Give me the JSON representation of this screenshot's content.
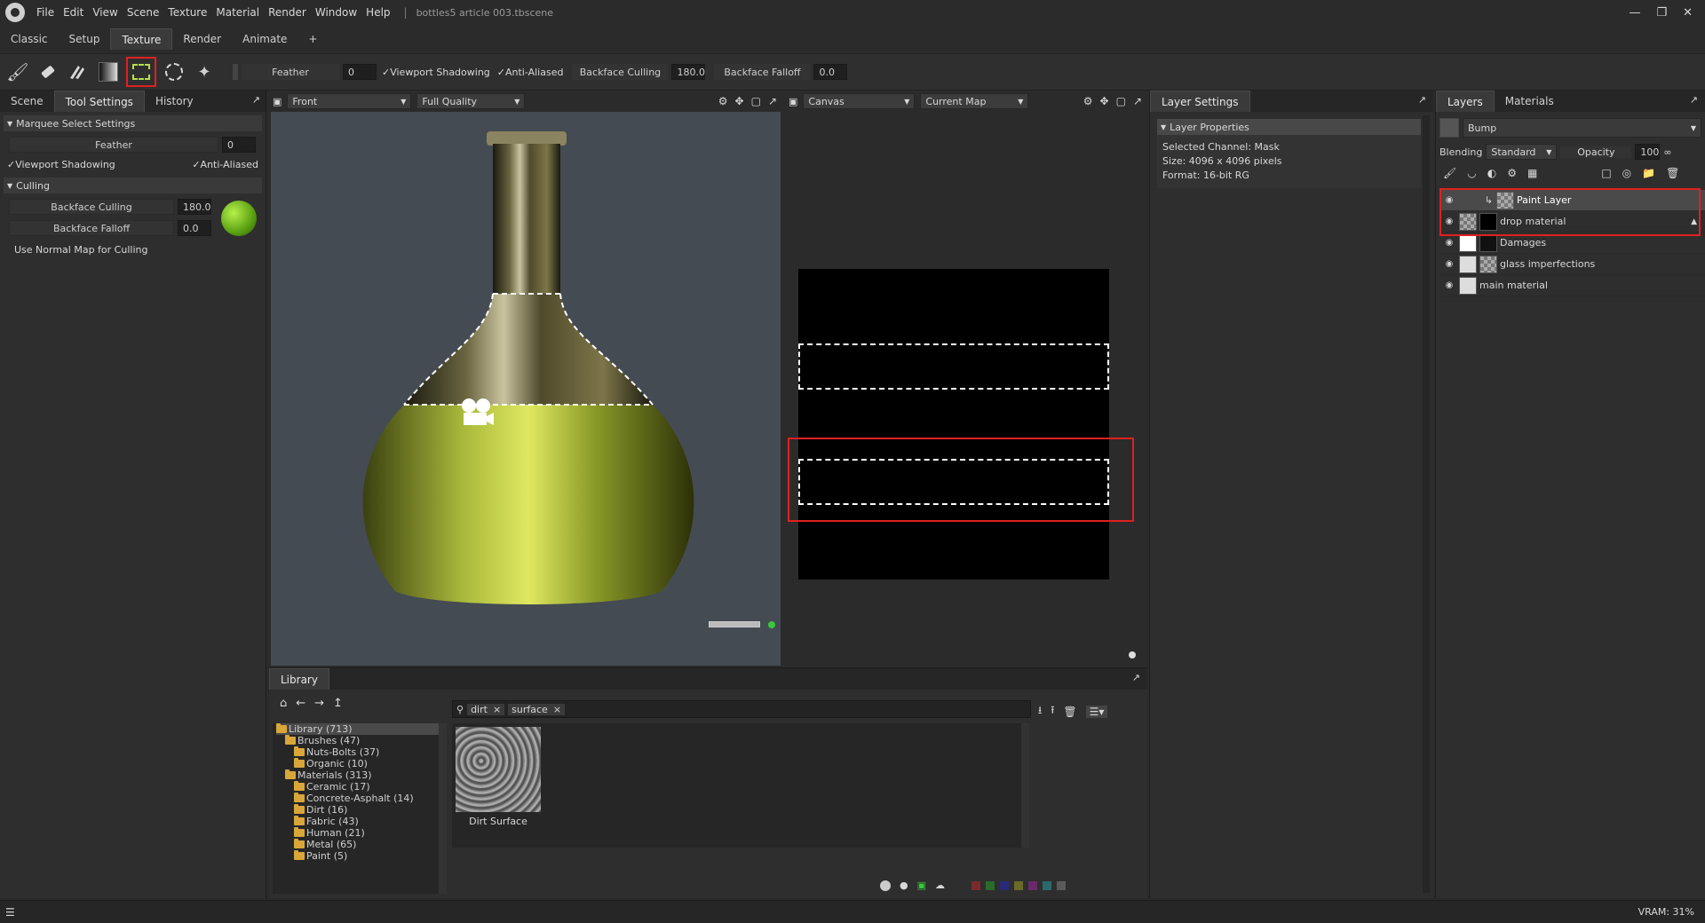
{
  "menubar": {
    "items": [
      "File",
      "Edit",
      "View",
      "Scene",
      "Texture",
      "Material",
      "Render",
      "Window",
      "Help"
    ],
    "filename": "bottles5 article 003.tbscene",
    "window_controls": [
      "minimize-icon",
      "restore-icon",
      "close-icon"
    ]
  },
  "workspace_tabs": [
    "Classic",
    "Setup",
    "Texture",
    "Render",
    "Animate",
    "+"
  ],
  "active_workspace": "Texture",
  "toolbar": {
    "tools": [
      "paint-brush-icon",
      "eraser-icon",
      "fill-icon",
      "gradient-icon",
      "marquee-select-icon",
      "lasso-select-icon",
      "magic-wand-icon"
    ],
    "feather_label": "Feather",
    "feather_value": "0",
    "viewport_shadowing": "✓Viewport Shadowing",
    "anti_aliased": "✓Anti-Aliased",
    "backface_culling_label": "Backface Culling",
    "backface_culling_value": "180.0",
    "backface_falloff_label": "Backface Falloff",
    "backface_falloff_value": "0.0"
  },
  "left_panel": {
    "tabs": [
      "Scene",
      "Tool Settings",
      "History"
    ],
    "active_tab": "Tool Settings",
    "marquee_section": "Marquee Select Settings",
    "feather_label": "Feather",
    "feather_value": "0",
    "viewport_shadowing": "✓Viewport Shadowing",
    "anti_aliased": "✓Anti-Aliased",
    "culling_section": "Culling",
    "backface_culling_label": "Backface Culling",
    "backface_culling_value": "180.0",
    "backface_falloff_label": "Backface Falloff",
    "backface_falloff_value": "0.0",
    "use_normal_map": "Use Normal Map for Culling"
  },
  "viewport": {
    "view_select": "Front",
    "quality_select": "Full Quality"
  },
  "canvas_view": {
    "canvas_select": "Canvas",
    "map_select": "Current Map"
  },
  "layer_settings": {
    "tab": "Layer Settings",
    "section": "Layer Properties",
    "selected_channel": "Selected Channel: Mask",
    "size": "Size: 4096 x 4096 pixels",
    "format": "Format: 16-bit RG"
  },
  "layers_panel": {
    "tabs": [
      "Layers",
      "Materials"
    ],
    "active_tab": "Layers",
    "channel_select": "Bump",
    "blending_label": "Blending",
    "blending_value": "Standard",
    "opacity_label": "Opacity",
    "opacity_value": "100",
    "layers": [
      {
        "name": "Paint Layer",
        "selected": true
      },
      {
        "name": "drop material",
        "selected": false
      },
      {
        "name": "Damages",
        "selected": false
      },
      {
        "name": "glass imperfections",
        "selected": false
      },
      {
        "name": "main material",
        "selected": false
      }
    ]
  },
  "library": {
    "tab": "Library",
    "search_tags": [
      "dirt",
      "surface"
    ],
    "tree": [
      {
        "label": "Library (713)",
        "depth": 0
      },
      {
        "label": "Brushes (47)",
        "depth": 1
      },
      {
        "label": "Nuts-Bolts (37)",
        "depth": 2
      },
      {
        "label": "Organic (10)",
        "depth": 2
      },
      {
        "label": "Materials (313)",
        "depth": 1
      },
      {
        "label": "Ceramic (17)",
        "depth": 2
      },
      {
        "label": "Concrete-Asphalt (14)",
        "depth": 2
      },
      {
        "label": "Dirt (16)",
        "depth": 2
      },
      {
        "label": "Fabric (43)",
        "depth": 2
      },
      {
        "label": "Human (21)",
        "depth": 2
      },
      {
        "label": "Metal (65)",
        "depth": 2
      },
      {
        "label": "Paint (5)",
        "depth": 2
      }
    ],
    "result_label": "Dirt Surface",
    "filter_colors": [
      "#7a2a2a",
      "#2a6a2a",
      "#2a2a7a",
      "#6a6a2a",
      "#6a2a6a",
      "#2a6a6a",
      "#5a5a5a"
    ]
  },
  "statusbar": {
    "vram": "VRAM: 31%"
  },
  "colors": {
    "accent_red": "#e02020",
    "bg": "#2b2b2b",
    "viewport_bg": "#454b52"
  }
}
